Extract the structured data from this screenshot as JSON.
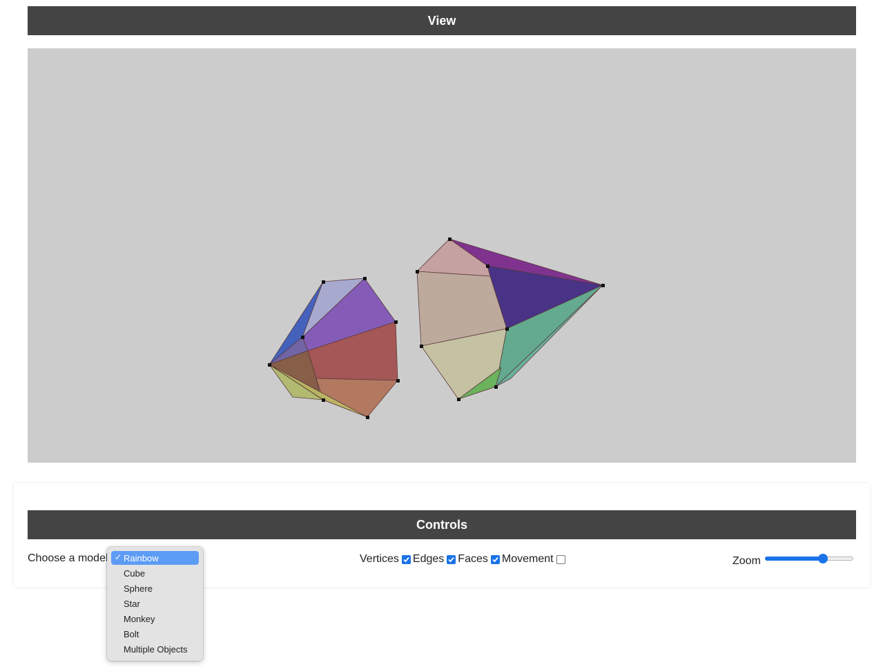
{
  "view": {
    "title": "View"
  },
  "controls": {
    "title": "Controls",
    "model_label": "Choose a model",
    "model_options": [
      "Rainbow",
      "Cube",
      "Sphere",
      "Star",
      "Monkey",
      "Bolt",
      "Multiple Objects"
    ],
    "selected_model": "Rainbow",
    "toggles": [
      {
        "label": "Vertices",
        "checked": true
      },
      {
        "label": "Edges",
        "checked": true
      },
      {
        "label": "Faces",
        "checked": true
      },
      {
        "label": "Movement",
        "checked": false
      }
    ],
    "zoom_label": "Zoom",
    "zoom_fraction": 0.66
  },
  "colors": {
    "header_bg": "#444444",
    "viewport_bg": "#cccccc",
    "accent": "#1a73e8",
    "selected_option": "#5d9cf5"
  }
}
